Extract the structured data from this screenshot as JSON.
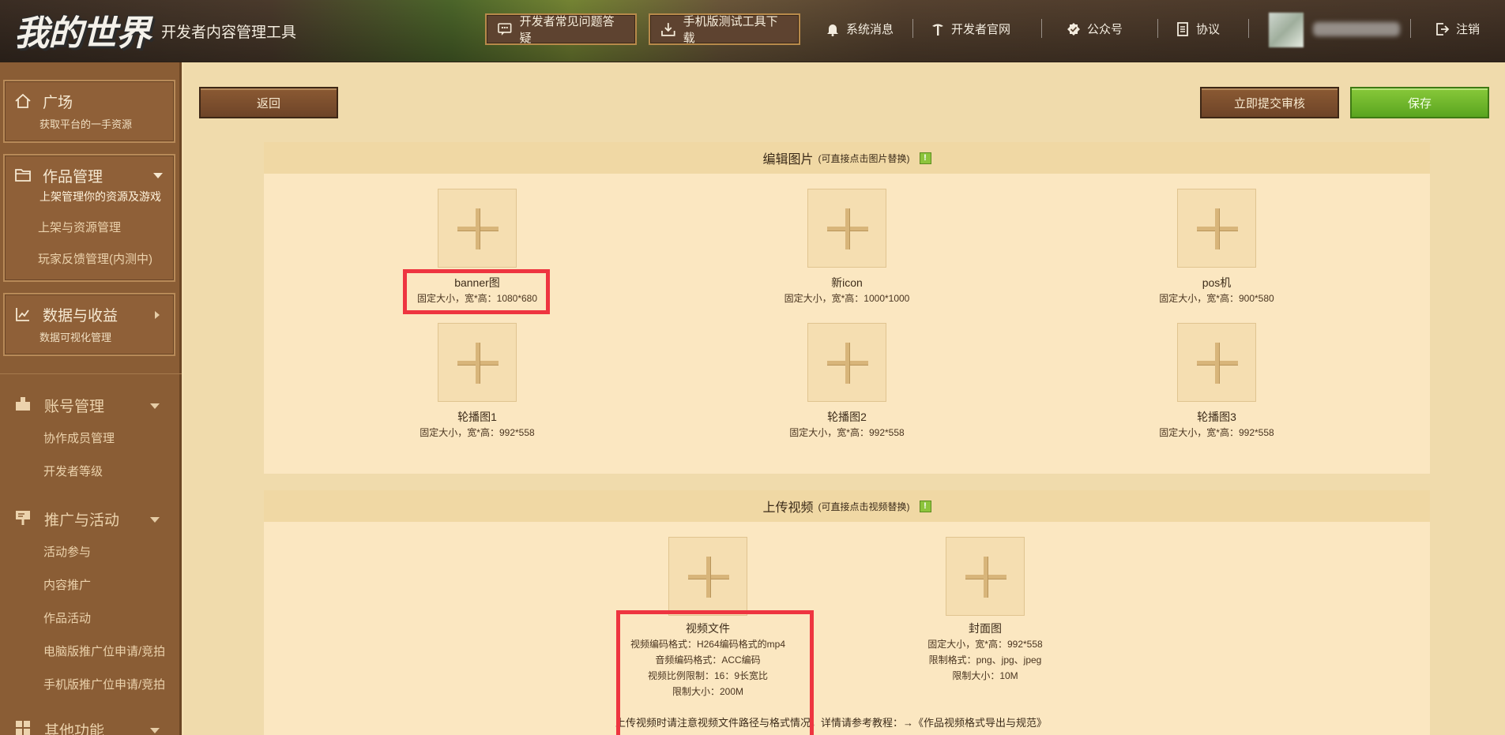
{
  "header": {
    "logo_text": "我的世界",
    "app_title": "开发者内容管理工具",
    "faq_button": "开发者常见问题答疑",
    "mobile_tool_button": "手机版测试工具下载",
    "nav": {
      "messages": "系统消息",
      "official_site": "开发者官网",
      "public_account": "公众号",
      "agreement": "协议",
      "logout": "注销"
    }
  },
  "sidebar": {
    "plaza": {
      "title": "广场",
      "subtitle": "获取平台的一手资源"
    },
    "works": {
      "title": "作品管理",
      "subtitle": "上架管理你的资源及游戏",
      "items": [
        "上架与资源管理",
        "玩家反馈管理(内测中)"
      ]
    },
    "data": {
      "title": "数据与收益",
      "subtitle": "数据可视化管理"
    },
    "account": {
      "title": "账号管理",
      "items": [
        "协作成员管理",
        "开发者等级"
      ]
    },
    "promo": {
      "title": "推广与活动",
      "items": [
        "活动参与",
        "内容推广",
        "作品活动",
        "电脑版推广位申请/竞拍",
        "手机版推广位申请/竞拍"
      ]
    },
    "other": {
      "title": "其他功能"
    }
  },
  "toolbar": {
    "back": "返回",
    "submit_review": "立即提交审核",
    "save": "保存"
  },
  "images_panel": {
    "title": "编辑图片",
    "hint": "(可直接点击图片替换)",
    "warn_icon": "!",
    "slots": [
      {
        "name": "banner图",
        "spec": "固定大小，宽*高：1080*680"
      },
      {
        "name": "新icon",
        "spec": "固定大小，宽*高：1000*1000"
      },
      {
        "name": "pos机",
        "spec": "固定大小，宽*高：900*580"
      },
      {
        "name": "轮播图1",
        "spec": "固定大小，宽*高：992*558"
      },
      {
        "name": "轮播图2",
        "spec": "固定大小，宽*高：992*558"
      },
      {
        "name": "轮播图3",
        "spec": "固定大小，宽*高：992*558"
      }
    ]
  },
  "video_panel": {
    "title": "上传视频",
    "hint": "(可直接点击视频替换)",
    "warn_icon": "!",
    "video_file": {
      "name": "视频文件",
      "specs": [
        "视频编码格式：H264编码格式的mp4",
        "音频编码格式：ACC编码",
        "视频比例限制：16：9长宽比",
        "限制大小：200M"
      ]
    },
    "cover": {
      "name": "封面图",
      "specs": [
        "固定大小，宽*高：992*558",
        "限制格式：png、jpg、jpeg",
        "限制大小：10M"
      ]
    },
    "note": "上传视频时请注意视频文件路径与格式情况，详情请参考教程：→《作品视频格式导出与规范》"
  },
  "colors": {
    "accent_green": "#6db52a",
    "highlight_red": "#ee3540",
    "sidebar_bg": "#8a5d35"
  }
}
